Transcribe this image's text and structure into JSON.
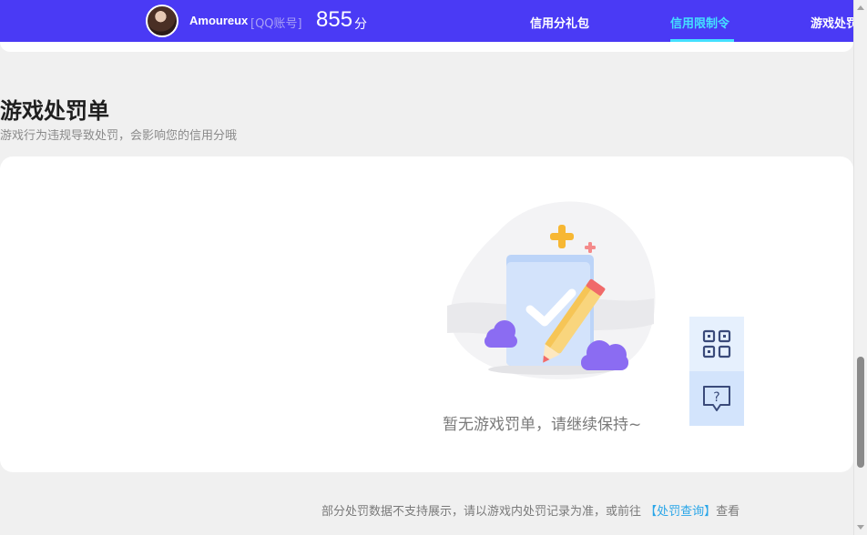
{
  "header": {
    "user_name": "Amoureux",
    "account_type": "[QQ账号]",
    "score": "855",
    "score_unit": "分",
    "nav": [
      {
        "label": "信用分礼包",
        "active": false
      },
      {
        "label": "信用限制令",
        "active": true
      },
      {
        "label": "游戏处罚",
        "active": false
      }
    ]
  },
  "section": {
    "title": "游戏处罚单",
    "subtitle": "游戏行为违规导致处罚，会影响您的信用分哦"
  },
  "empty_state": {
    "message": "暂无游戏罚单，请继续保持~"
  },
  "float_buttons": {
    "qr_icon": "qr-code-icon",
    "help_icon": "help-chat-icon"
  },
  "footer": {
    "note_prefix": "部分处罚数据不支持展示，请以游戏内处罚记录为准，或前往",
    "link_label": "【处罚查询】",
    "note_suffix": "查看"
  },
  "colors": {
    "header_bg": "#4a3af5",
    "active_nav": "#44e0ff",
    "link": "#2aa6e8"
  }
}
